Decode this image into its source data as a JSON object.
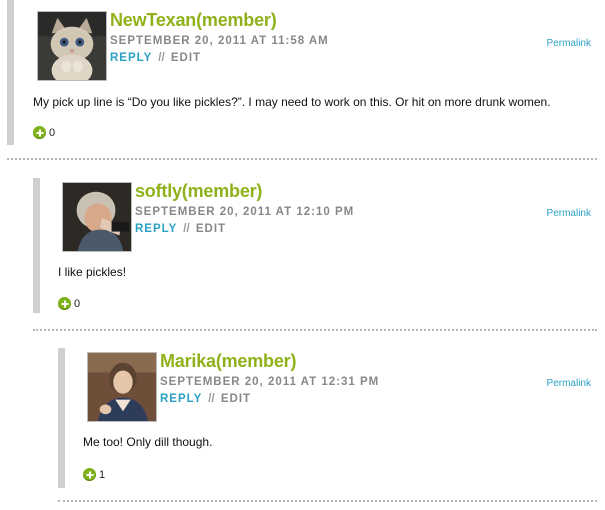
{
  "comments": [
    {
      "author": "NewTexan(member)",
      "date": "SEPTEMBER 20, 2011 AT 11:58 AM",
      "reply": "REPLY",
      "separator": "//",
      "edit": "EDIT",
      "permalink": "Permalink",
      "text": "My pick up line is “Do you like pickles?”. I may need to work on this. Or hit on more drunk women.",
      "votes": "0",
      "avatar_icon": "kitten-avatar-icon"
    },
    {
      "author": "softly(member)",
      "date": "SEPTEMBER 20, 2011 AT 12:10 PM",
      "reply": "REPLY",
      "separator": "//",
      "edit": "EDIT",
      "permalink": "Permalink",
      "text": "I like pickles!",
      "votes": "0",
      "avatar_icon": "person-avatar-icon"
    },
    {
      "author": "Marika(member)",
      "date": "SEPTEMBER 20, 2011 AT 12:31 PM",
      "reply": "REPLY",
      "separator": "//",
      "edit": "EDIT",
      "permalink": "Permalink",
      "text": "Me too! Only dill though.",
      "votes": "1",
      "avatar_icon": "person-avatar-icon"
    }
  ],
  "colors": {
    "author": "#8fb21a",
    "link": "#2aa1c4",
    "meta": "#888888",
    "vote_icon": "#7fb11c",
    "thread_bar": "#cfcfcf"
  }
}
